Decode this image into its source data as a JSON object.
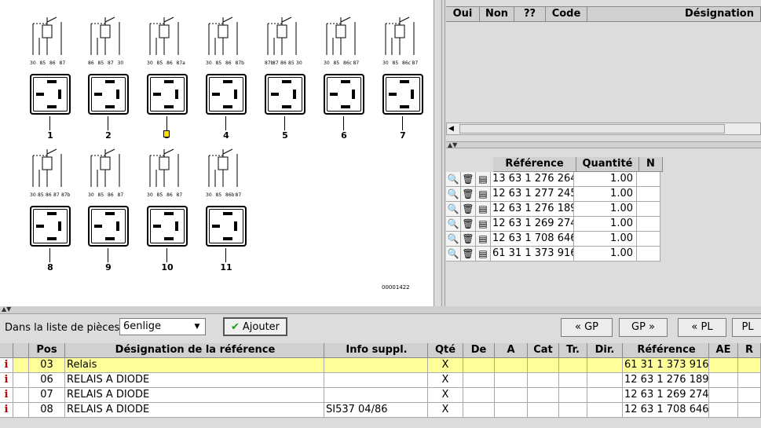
{
  "diagram": {
    "doc_number": "00001422",
    "relays": [
      {
        "num": "1",
        "pins": [
          "30",
          "85",
          "86",
          "87"
        ]
      },
      {
        "num": "2",
        "pins": [
          "86",
          "85",
          "87",
          "30"
        ]
      },
      {
        "num": "3",
        "pins": [
          "30",
          "85",
          "86",
          "87a"
        ]
      },
      {
        "num": "4",
        "pins": [
          "30",
          "85",
          "86",
          "87b"
        ]
      },
      {
        "num": "5",
        "pins": [
          "87b",
          "87",
          "86",
          "85",
          "30"
        ]
      },
      {
        "num": "6",
        "pins": [
          "30",
          "85",
          "86c",
          "87"
        ]
      },
      {
        "num": "7",
        "pins": [
          "30",
          "85",
          "86c",
          "87"
        ]
      },
      {
        "num": "8",
        "pins": [
          "30",
          "85",
          "86",
          "87",
          "87b"
        ]
      },
      {
        "num": "9",
        "pins": [
          "30",
          "85",
          "86",
          "87"
        ]
      },
      {
        "num": "10",
        "pins": [
          "30",
          "85",
          "86",
          "87"
        ]
      },
      {
        "num": "11",
        "pins": [
          "30",
          "85",
          "86b",
          "87"
        ]
      }
    ]
  },
  "choose_table": {
    "headers": [
      "Oui",
      "Non",
      "??",
      "Code",
      "Désignation"
    ]
  },
  "ref_table": {
    "headers": [
      "Référence",
      "Quantité",
      "N"
    ],
    "rows": [
      {
        "ref": "13 63 1 276 264",
        "qty": "1.00"
      },
      {
        "ref": "12 63 1 277 245",
        "qty": "1.00"
      },
      {
        "ref": "12 63 1 276 189",
        "qty": "1.00"
      },
      {
        "ref": "12 63 1 269 274",
        "qty": "1.00"
      },
      {
        "ref": "12 63 1 708 646",
        "qty": "1.00"
      },
      {
        "ref": "61 31 1 373 916",
        "qty": "1.00"
      }
    ]
  },
  "toolbar": {
    "label": "Dans la liste de pièces",
    "list_value": "6enlige",
    "add_label": "Ajouter",
    "nav": [
      "« GP",
      "GP »",
      "« PL",
      "PL"
    ]
  },
  "parts_table": {
    "headers": [
      "",
      "Pos",
      "Désignation de la référence",
      "Info suppl.",
      "Qté",
      "De",
      "A",
      "Cat",
      "Tr.",
      "Dir.",
      "Référence",
      "AE",
      "R"
    ],
    "rows": [
      {
        "pos": "03",
        "des": "Relais",
        "sup": "",
        "qte": "X",
        "ref": "61 31 1 373 916",
        "selected": true
      },
      {
        "pos": "06",
        "des": "RELAIS A DIODE",
        "sup": "",
        "qte": "X",
        "ref": "12 63 1 276 189",
        "selected": false
      },
      {
        "pos": "07",
        "des": "RELAIS A DIODE",
        "sup": "",
        "qte": "X",
        "ref": "12 63 1 269 274",
        "selected": false
      },
      {
        "pos": "08",
        "des": "RELAIS A DIODE",
        "sup": "SI537 04/86",
        "qte": "X",
        "ref": "12 63 1 708 646",
        "selected": false
      }
    ]
  }
}
